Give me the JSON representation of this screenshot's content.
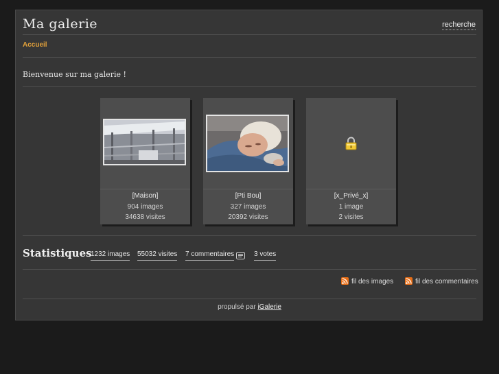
{
  "header": {
    "title": "Ma galerie",
    "search_label": "recherche"
  },
  "breadcrumb": {
    "home_label": "Accueil"
  },
  "welcome_text": "Bienvenue sur ma galerie !",
  "albums": [
    {
      "name": "[Maison]",
      "images": "904 images",
      "visits": "34638 visites",
      "thumb": "house-construction-photo"
    },
    {
      "name": "[Pti Bou]",
      "images": "327 images",
      "visits": "20392 visites",
      "thumb": "baby-photo"
    },
    {
      "name": "[x_Privé_x]",
      "images": "1 image",
      "visits": "2 visites",
      "thumb": "lock-icon"
    }
  ],
  "statistics": {
    "title": "Statistiques",
    "images": "1232 images",
    "visits": "55032 visites",
    "comments": "7 commentaires",
    "votes": "3 votes"
  },
  "feeds": {
    "images_label": "fil des images",
    "comments_label": "fil des commentaires"
  },
  "footer": {
    "powered_by": "propulsé par",
    "link_label": "iGalerie"
  },
  "colors": {
    "background": "#1b1b1b",
    "panel": "#363636",
    "accent": "#e0a03a",
    "rss": "#e86e16"
  }
}
